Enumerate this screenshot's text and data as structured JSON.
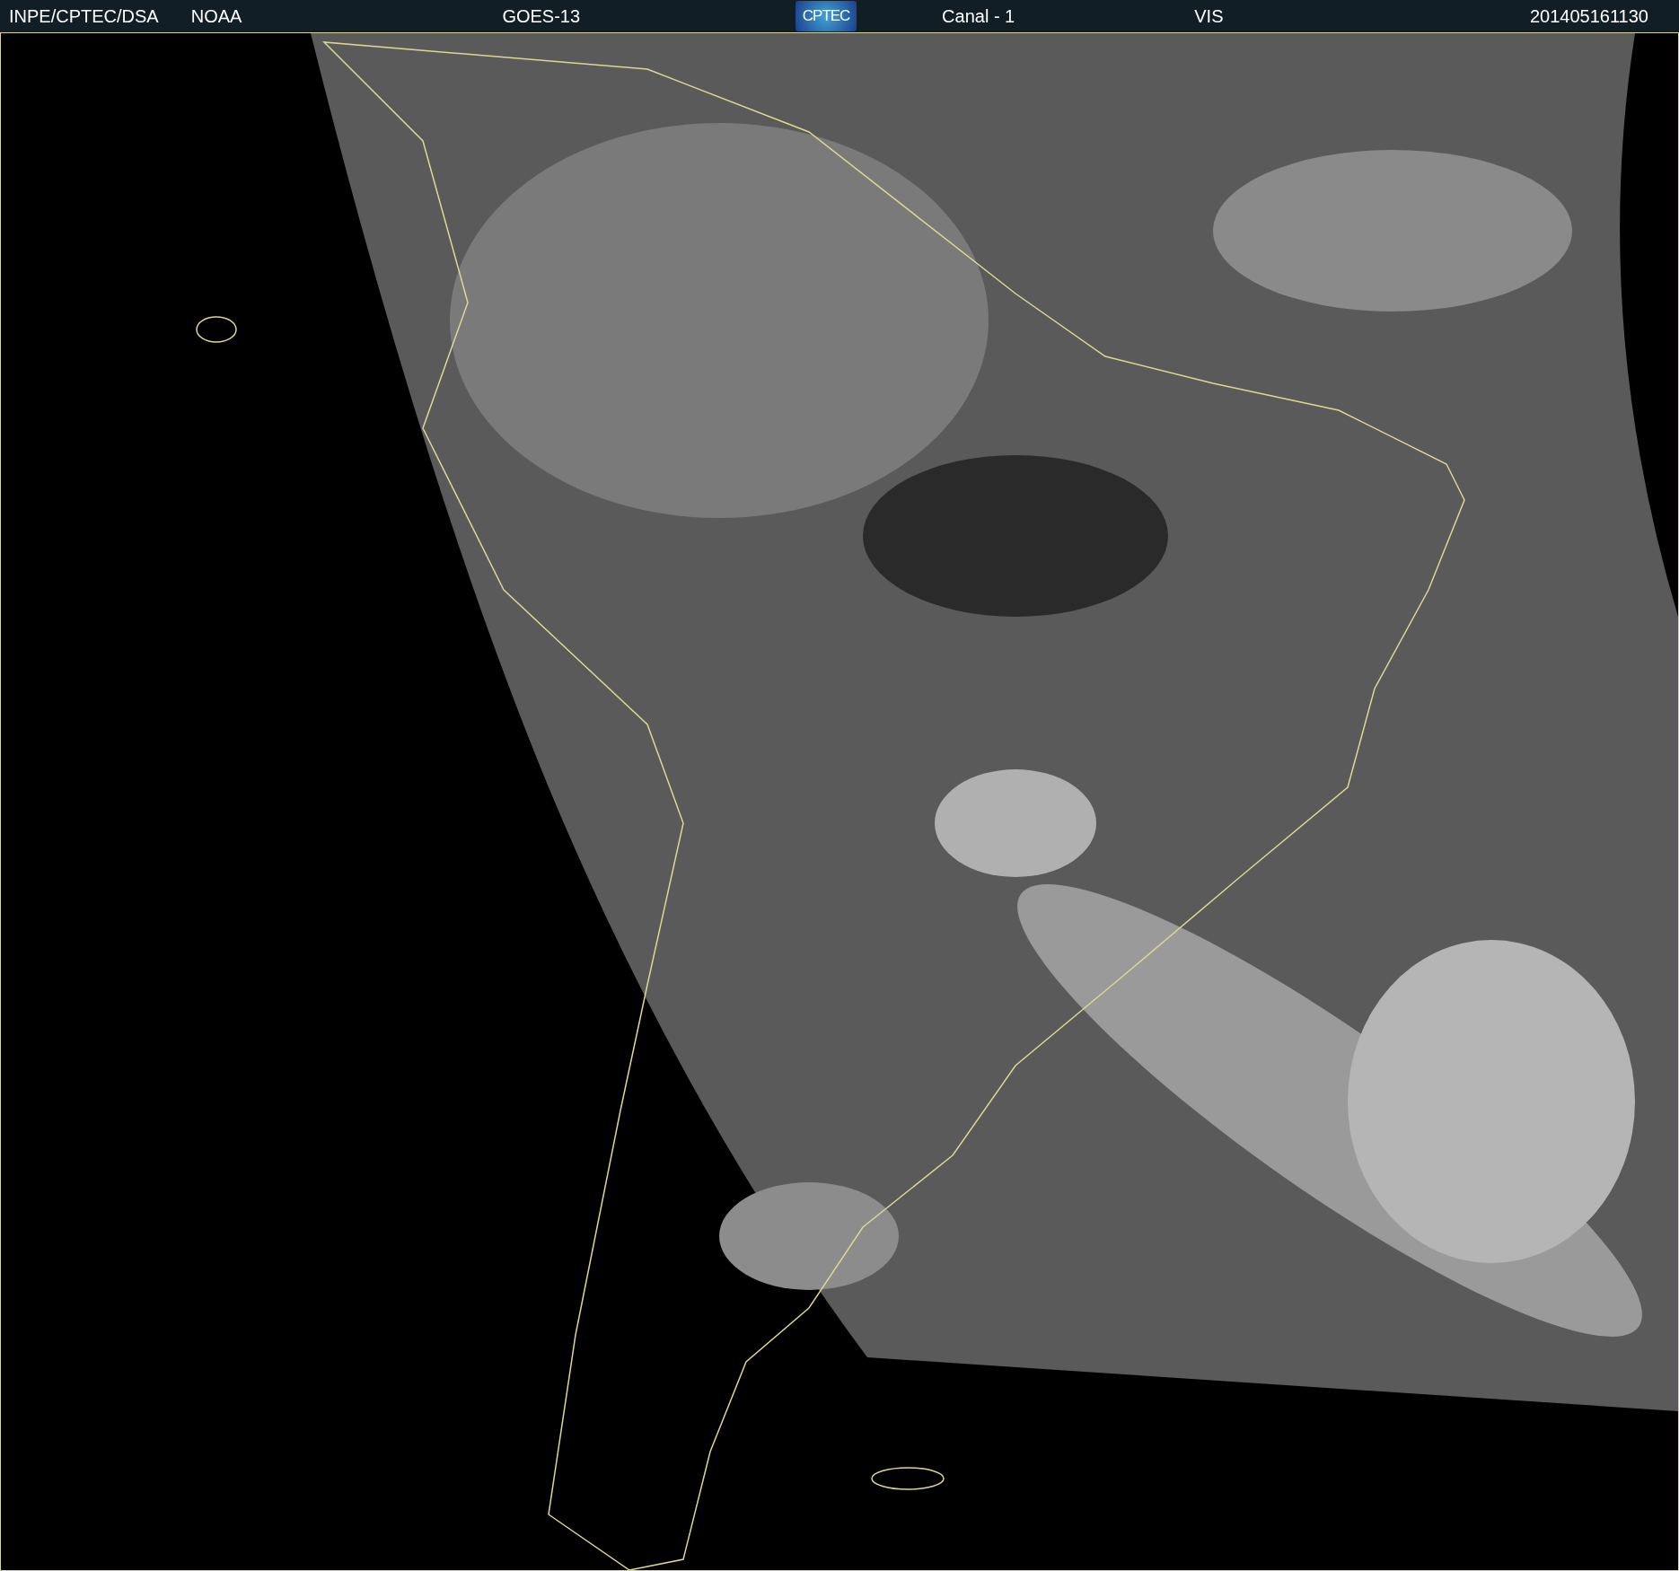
{
  "header": {
    "items": [
      {
        "kind": "text",
        "text": "INPE/CPTEC/DSA"
      },
      {
        "kind": "text",
        "text": "NOAA"
      },
      {
        "kind": "text",
        "text": "GOES-13"
      },
      {
        "kind": "logo",
        "text": "CPTEC"
      },
      {
        "kind": "text",
        "text": "Canal - 1"
      },
      {
        "kind": "text",
        "text": "VIS"
      },
      {
        "kind": "text",
        "text": "201405161130"
      }
    ]
  }
}
